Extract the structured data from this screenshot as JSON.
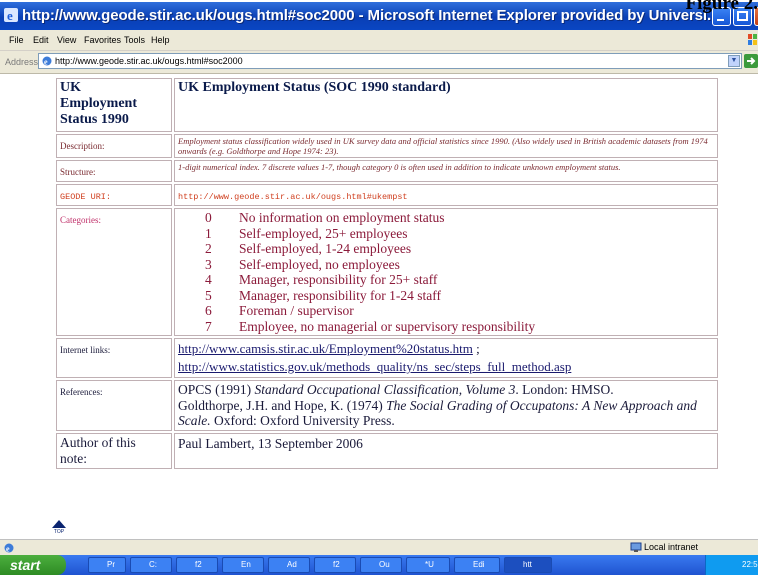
{
  "figure_label": "Figure 2.",
  "window": {
    "title": "http://www.geode.stir.ac.uk/ougs.html#soc2000 - Microsoft Internet Explorer provided by Universi...",
    "icon": "ie-icon"
  },
  "menu": [
    "File",
    "Edit",
    "View",
    "Favorites",
    "Tools",
    "Help"
  ],
  "address": {
    "label": "Address",
    "url": "http://www.geode.stir.ac.uk/ougs.html#soc2000",
    "go_label": "Go"
  },
  "page": {
    "header_left": "UK Employment Status 1990",
    "header_right": "UK Employment Status (SOC 1990 standard)",
    "description_label": "Description:",
    "description": "Employment status classification widely used in UK survey data and official statistics since 1990. (Also widely used in British academic datasets from 1974 onwards (e.g. Goldthorpe and Hope 1974: 23).",
    "structure_label": "Structure:",
    "structure": "1-digit numerical index. 7 discrete values 1-7, though category 0 is often used in addition to indicate unknown employment status.",
    "uri_label": "GEODE URI:",
    "uri": "http://www.geode.stir.ac.uk/ougs.html#ukempst",
    "categories_label": "Categories:",
    "categories": [
      {
        "code": "0",
        "label": "No information on employment status"
      },
      {
        "code": "1",
        "label": "Self-employed, 25+ employees"
      },
      {
        "code": "2",
        "label": "Self-employed, 1-24 employees"
      },
      {
        "code": "3",
        "label": "Self-employed, no employees"
      },
      {
        "code": "4",
        "label": "Manager, responsibility for 25+ staff"
      },
      {
        "code": "5",
        "label": "Manager, responsibility for 1-24 staff"
      },
      {
        "code": "6",
        "label": "Foreman / supervisor"
      },
      {
        "code": "7",
        "label": "Employee, no managerial or supervisory responsibility"
      }
    ],
    "links_label": "Internet links:",
    "link1": "http://www.camsis.stir.ac.uk/Employment%20status.htm",
    "link1_sep": " ;",
    "link2": "http://www.statistics.gov.uk/methods_quality/ns_sec/steps_full_method.asp",
    "references_label": "References:",
    "ref1_plain": "OPCS (1991) ",
    "ref1_italic": "Standard Occupational Classification, Volume 3",
    "ref1_tail": ". London: HMSO.",
    "ref2_plain": "Goldthorpe, J.H. and Hope, K. (1974) ",
    "ref2_italic": "The Social Grading of Occupatons: A New Approach and Scale.",
    "ref2_tail": " Oxford: Oxford University Press.",
    "author_label": "Author of this note:",
    "author": "Paul Lambert, 13 September 2006",
    "top_label": "TOP"
  },
  "status": {
    "zone": "Local intranet"
  },
  "taskbar": {
    "start": "start",
    "tasks": [
      "Pr",
      "C:",
      "f2",
      "En",
      "Ad",
      "f2",
      "Ou",
      "*U",
      "Edi",
      "htt"
    ],
    "clock": "22:5"
  }
}
